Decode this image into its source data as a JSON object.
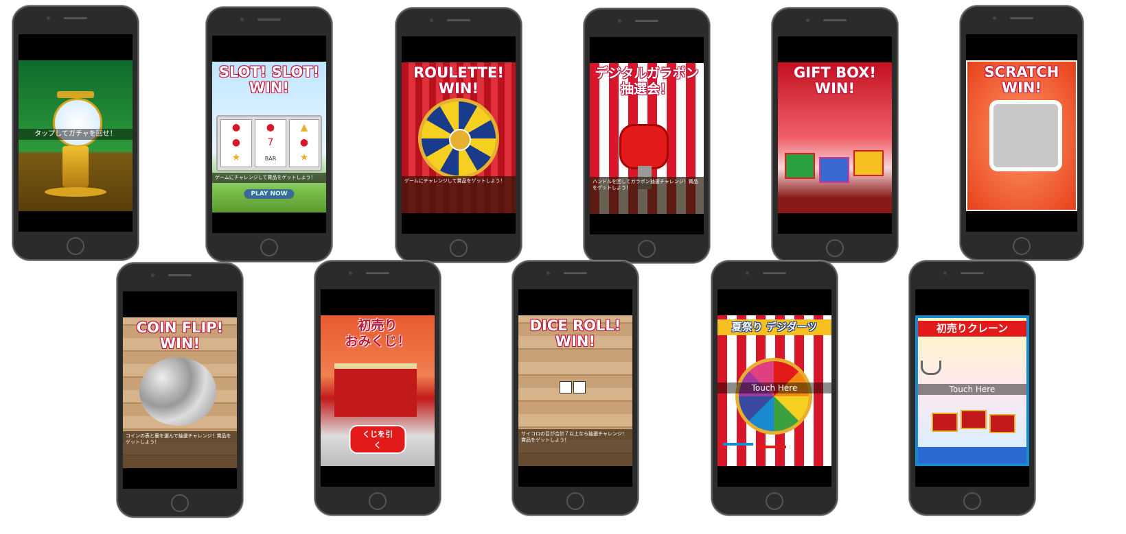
{
  "games": [
    {
      "id": "gacha",
      "title": "",
      "caption": "",
      "touch": "タップしてガチャを回せ！"
    },
    {
      "id": "slot",
      "title": "SLOT! SLOT!\nWIN!",
      "caption": "ゲームにチャレンジして賞品をゲットしよう！",
      "button": "PLAY NOW",
      "slot_reel_label": "BAR"
    },
    {
      "id": "roulette",
      "title": "ROULETTE!\nWIN!",
      "caption": "ゲームにチャレンジして賞品をゲットしよう！"
    },
    {
      "id": "gachapon",
      "title": "デジタルガラポン\n抽選会！",
      "caption": "ハンドルを回してガラポン抽選チャレンジ！賞品をゲットしよう！"
    },
    {
      "id": "giftbox",
      "title": "GIFT BOX!\nWIN!",
      "caption": ""
    },
    {
      "id": "scratch",
      "title": "SCRATCH\nWIN!",
      "caption": ""
    },
    {
      "id": "coinflip",
      "title": "COIN FLIP!\nWIN!",
      "caption": "コインの表と裏を選んで抽選チャレンジ！賞品をゲットしよう！"
    },
    {
      "id": "omikuji",
      "title": "初売り\nおみくじ！",
      "caption": "",
      "button": "くじを引く"
    },
    {
      "id": "dice",
      "title": "DICE ROLL!\nWIN!",
      "caption": "サイコロの目が合計７以上なら抽選チャレンジ！賞品をゲットしよう！"
    },
    {
      "id": "darts",
      "title": "夏祭り デジダーツ",
      "caption": "",
      "touch": "Touch Here"
    },
    {
      "id": "crane",
      "title": "初売りクレーン",
      "caption": "",
      "touch": "Touch Here"
    }
  ],
  "colors": {
    "title_outline": "#c0143c",
    "phone_body": "#2b2b2b",
    "accent_red": "#d9162a",
    "gold": "#e8b030"
  }
}
